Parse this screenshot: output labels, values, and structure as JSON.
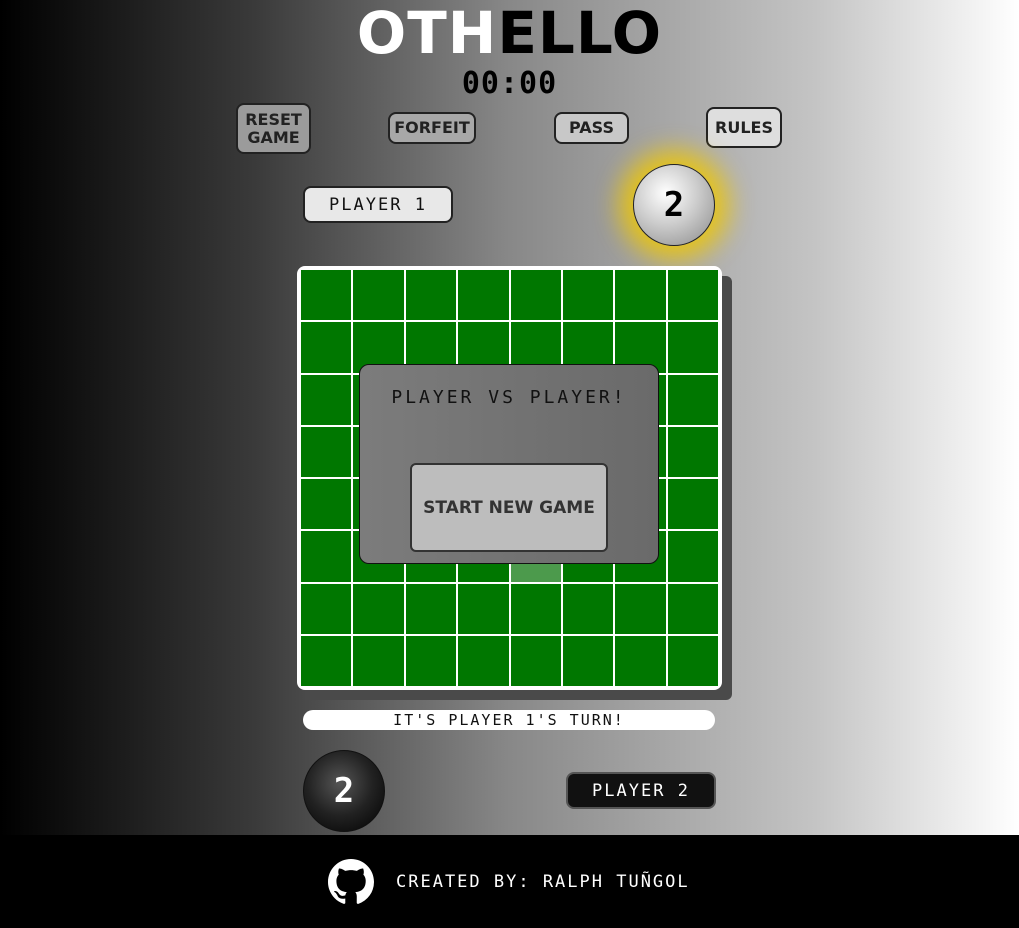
{
  "title": {
    "part1": "OTH",
    "part2": "ELLO"
  },
  "timer": "00:00",
  "controls": {
    "reset_line1": "RESET",
    "reset_line2": "GAME",
    "forfeit": "FORFEIT",
    "pass": "PASS",
    "rules": "RULES"
  },
  "players": {
    "player1_label": "PLAYER 1",
    "player2_label": "PLAYER 2",
    "white_score": "2",
    "black_score": "2"
  },
  "board": {
    "rows": 8,
    "cols": 8,
    "highlighted_cells": [
      [
        5,
        4
      ]
    ],
    "cell_color": "#007700",
    "hint_color": "#4c9a4c"
  },
  "modal": {
    "title": "PLAYER VS PLAYER!",
    "start_button": "START NEW GAME"
  },
  "status": "IT'S PLAYER 1'S TURN!",
  "footer": {
    "credit": "CREATED BY: RALPH TUÑGOL",
    "icon": "github-icon"
  },
  "colors": {
    "glow": "#f0c800",
    "footer_bg": "#000000"
  }
}
